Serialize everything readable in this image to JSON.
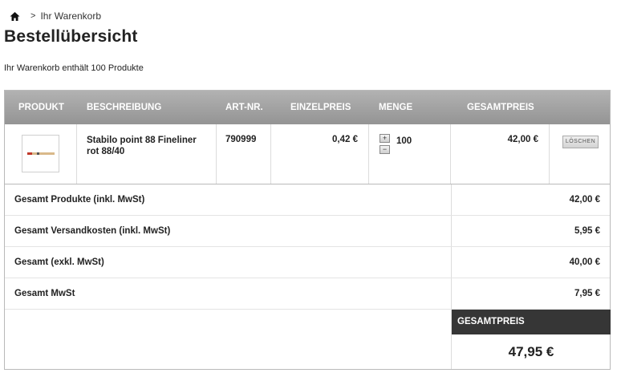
{
  "breadcrumb": {
    "home_icon": "home-icon",
    "separator": ">",
    "current": "Ihr Warenkorb"
  },
  "page_title": "Bestellübersicht",
  "cart_summary": "Ihr Warenkorb enthält 100 Produkte",
  "table": {
    "headers": {
      "product": "PRODUKT",
      "description": "BESCHREIBUNG",
      "artnr": "ART-NR.",
      "unit_price": "EINZELPREIS",
      "quantity": "MENGE",
      "total_price": "GESAMTPREIS"
    },
    "items": [
      {
        "image_icon": "fineliner-pen-image",
        "description": "Stabilo point 88 Fineliner rot 88/40",
        "artnr": "790999",
        "unit_price": "0,42 €",
        "qty_plus": "+",
        "qty_minus": "−",
        "quantity": "100",
        "total_price": "42,00 €",
        "delete_label": "LÖSCHEN"
      }
    ]
  },
  "totals": {
    "rows": [
      {
        "label": "Gesamt Produkte (inkl. MwSt)",
        "value": "42,00 €"
      },
      {
        "label": "Gesamt Versandkosten (inkl. MwSt)",
        "value": "5,95 €"
      },
      {
        "label": "Gesamt (exkl. MwSt)",
        "value": "40,00 €"
      },
      {
        "label": "Gesamt MwSt",
        "value": "7,95 €"
      }
    ],
    "grand_total_label": "GESAMTPREIS",
    "grand_total_value": "47,95 €"
  },
  "colors": {
    "header_bg": "#a0a0a0",
    "grand_total_bg": "#363636",
    "border": "#b9b9b9"
  }
}
